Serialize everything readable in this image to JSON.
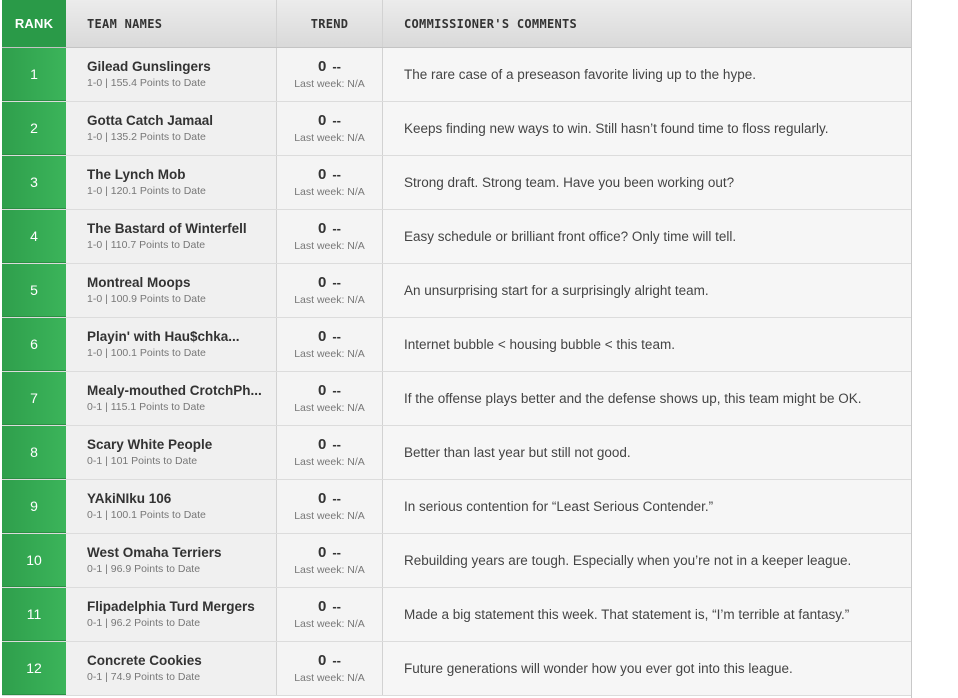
{
  "header": {
    "rank": "RANK",
    "team": "TEAM NAMES",
    "trend": "TREND",
    "comments": "COMMISSIONER'S COMMENTS"
  },
  "rows": [
    {
      "rank": "1",
      "name": "Gilead Gunslingers",
      "record": "1-0 | 155.4 Points to Date",
      "trend": "0",
      "trend_dash": "--",
      "last_week": "Last week: N/A",
      "comment": "The rare case of a preseason favorite living up to the hype."
    },
    {
      "rank": "2",
      "name": "Gotta Catch Jamaal",
      "record": "1-0 | 135.2 Points to Date",
      "trend": "0",
      "trend_dash": "--",
      "last_week": "Last week: N/A",
      "comment": "Keeps finding new ways to win. Still hasn’t found time to floss regularly."
    },
    {
      "rank": "3",
      "name": "The Lynch Mob",
      "record": "1-0 | 120.1 Points to Date",
      "trend": "0",
      "trend_dash": "--",
      "last_week": "Last week: N/A",
      "comment": "Strong draft. Strong team. Have you been working out?"
    },
    {
      "rank": "4",
      "name": "The Bastard of Winterfell",
      "record": "1-0 | 110.7 Points to Date",
      "trend": "0",
      "trend_dash": "--",
      "last_week": "Last week: N/A",
      "comment": "Easy schedule or brilliant front office? Only time will tell."
    },
    {
      "rank": "5",
      "name": "Montreal Moops",
      "record": "1-0 | 100.9 Points to Date",
      "trend": "0",
      "trend_dash": "--",
      "last_week": "Last week: N/A",
      "comment": "An unsurprising start for a surprisingly alright team."
    },
    {
      "rank": "6",
      "name": "Playin' with  Hau$chka...",
      "record": "1-0 | 100.1 Points to Date",
      "trend": "0",
      "trend_dash": "--",
      "last_week": "Last week: N/A",
      "comment": "Internet bubble < housing bubble < this team."
    },
    {
      "rank": "7",
      "name": "Mealy-mouthed CrotchPh...",
      "record": "0-1 | 115.1 Points to Date",
      "trend": "0",
      "trend_dash": "--",
      "last_week": "Last week: N/A",
      "comment": "If the offense plays better and the defense shows up, this team might be OK."
    },
    {
      "rank": "8",
      "name": "Scary White People",
      "record": "0-1 | 101 Points to Date",
      "trend": "0",
      "trend_dash": "--",
      "last_week": "Last week: N/A",
      "comment": "Better than last year but still not good."
    },
    {
      "rank": "9",
      "name": "YAkiNIku 106",
      "record": "0-1 | 100.1 Points to Date",
      "trend": "0",
      "trend_dash": "--",
      "last_week": "Last week: N/A",
      "comment": "In serious contention for “Least Serious Contender.”"
    },
    {
      "rank": "10",
      "name": "West Omaha Terriers",
      "record": "0-1 | 96.9 Points to Date",
      "trend": "0",
      "trend_dash": "--",
      "last_week": "Last week: N/A",
      "comment": "Rebuilding years are tough. Especially when you’re not in a keeper league."
    },
    {
      "rank": "11",
      "name": "Flipadelphia Turd Mergers",
      "record": "0-1 | 96.2 Points to Date",
      "trend": "0",
      "trend_dash": "--",
      "last_week": "Last week: N/A",
      "comment": "Made a big statement this week. That statement is, “I’m terrible at fantasy.”"
    },
    {
      "rank": "12",
      "name": "Concrete Cookies",
      "record": "0-1 | 74.9 Points to Date",
      "trend": "0",
      "trend_dash": "--",
      "last_week": "Last week: N/A",
      "comment": "Future generations will wonder how you ever got into this league."
    }
  ]
}
